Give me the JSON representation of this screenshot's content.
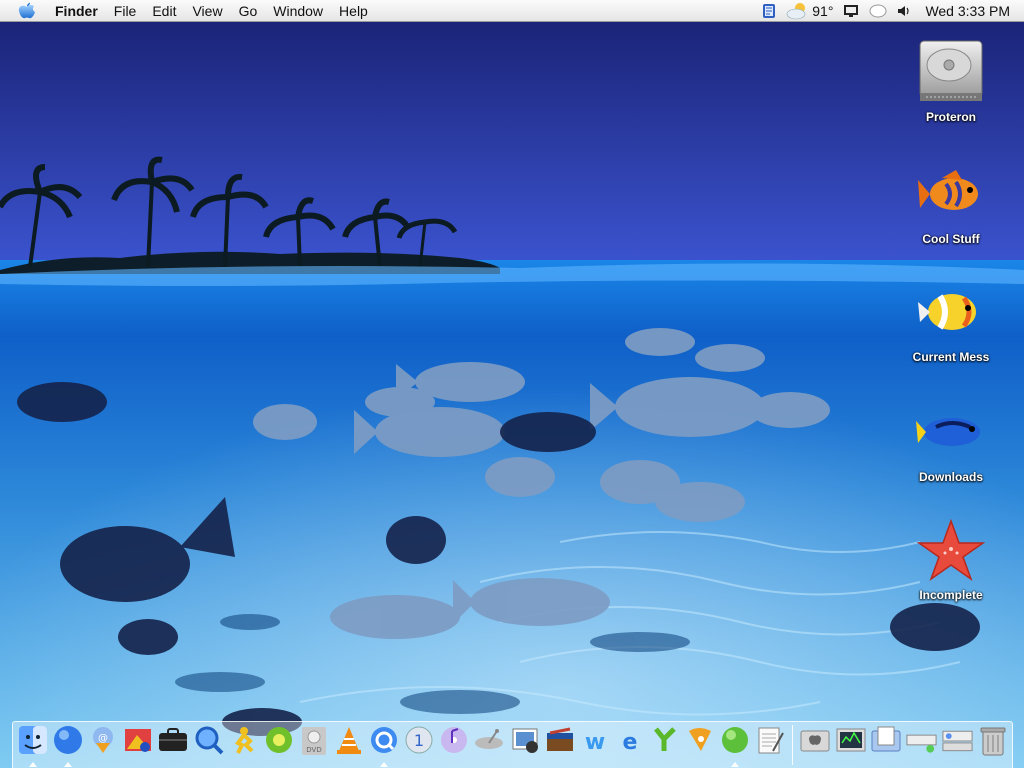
{
  "menubar": {
    "app_name": "Finder",
    "items": [
      "File",
      "Edit",
      "View",
      "Go",
      "Window",
      "Help"
    ],
    "weather_temp": "91°",
    "clock": "Wed 3:33 PM",
    "extras": [
      "script-menu-icon",
      "weather-icon",
      "display-icon",
      "bubble-icon",
      "volume-icon"
    ]
  },
  "desktop": {
    "icons": [
      {
        "label": "Proteron",
        "icon": "hard-drive-icon"
      },
      {
        "label": "Cool Stuff",
        "icon": "orange-fish-icon"
      },
      {
        "label": "Current Mess",
        "icon": "yellow-fish-icon"
      },
      {
        "label": "Downloads",
        "icon": "blue-tang-icon"
      },
      {
        "label": "Incomplete",
        "icon": "starfish-icon"
      }
    ]
  },
  "dock": {
    "apps": [
      {
        "name": "finder-icon",
        "running": true
      },
      {
        "name": "internet-explorer-icon",
        "running": true
      },
      {
        "name": "mail-icon",
        "running": false
      },
      {
        "name": "photo-app-icon",
        "running": false
      },
      {
        "name": "briefcase-icon",
        "running": false
      },
      {
        "name": "sherlock-icon",
        "running": false
      },
      {
        "name": "aim-icon",
        "running": false
      },
      {
        "name": "green-app-icon",
        "running": false
      },
      {
        "name": "dvd-player-icon",
        "running": false
      },
      {
        "name": "vlc-icon",
        "running": false
      },
      {
        "name": "quicktime-icon",
        "running": true
      },
      {
        "name": "itunes-icon",
        "running": false
      },
      {
        "name": "itunes-cd-icon",
        "running": false
      },
      {
        "name": "satellite-icon",
        "running": false
      },
      {
        "name": "iphoto-icon",
        "running": false
      },
      {
        "name": "toolbox-icon",
        "running": false
      },
      {
        "name": "web-editor-icon",
        "running": false
      },
      {
        "name": "web-app-icon",
        "running": false
      },
      {
        "name": "tool-icon",
        "running": false
      },
      {
        "name": "pen-tool-icon",
        "running": false
      },
      {
        "name": "green-orb-icon",
        "running": true
      },
      {
        "name": "textedit-icon",
        "running": false
      }
    ],
    "docs": [
      {
        "name": "apple-folder-icon"
      },
      {
        "name": "system-monitor-icon"
      },
      {
        "name": "documents-icon"
      },
      {
        "name": "network-icon"
      },
      {
        "name": "network-icon-2"
      },
      {
        "name": "trash-icon"
      }
    ]
  },
  "colors": {
    "sky_top": "#1e2a8a",
    "sky_bottom": "#3a4fd0",
    "water": "#1f7be0",
    "sand": "#6fc0f0"
  }
}
